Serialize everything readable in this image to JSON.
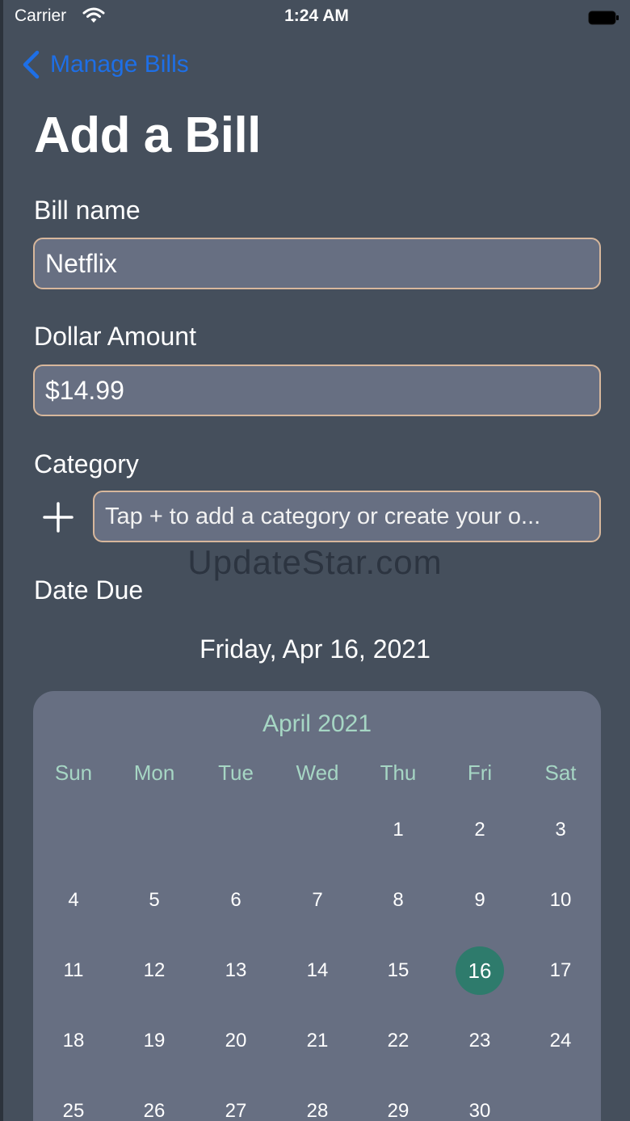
{
  "status_bar": {
    "carrier": "Carrier",
    "time": "1:24 AM",
    "wifi_icon": "wifi-icon",
    "battery_icon": "battery-icon"
  },
  "nav": {
    "back_label": "Manage Bills",
    "back_icon": "chevron-left-icon",
    "title": "Add a Bill"
  },
  "form": {
    "bill_name_label": "Bill name",
    "bill_name_value": "Netflix",
    "amount_label": "Dollar Amount",
    "amount_value": "$14.99",
    "category_label": "Category",
    "category_add_icon": "plus-icon",
    "category_placeholder": "Tap + to add a category or create your o...",
    "date_due_label": "Date Due",
    "selected_date_text": "Friday, Apr 16, 2021"
  },
  "watermark": "UpdateStar.com",
  "calendar": {
    "month_label": "April 2021",
    "weekdays": [
      "Sun",
      "Mon",
      "Tue",
      "Wed",
      "Thu",
      "Fri",
      "Sat"
    ],
    "first_weekday_index": 4,
    "days_in_view": 30,
    "selected_day": 16
  },
  "colors": {
    "background": "#454f5c",
    "field_background": "#676f82",
    "field_border": "#d7b79c",
    "accent_blue": "#1e6fe6",
    "calendar_accent": "#a6d6c4",
    "selected_day_fill": "#2e7b6c"
  }
}
